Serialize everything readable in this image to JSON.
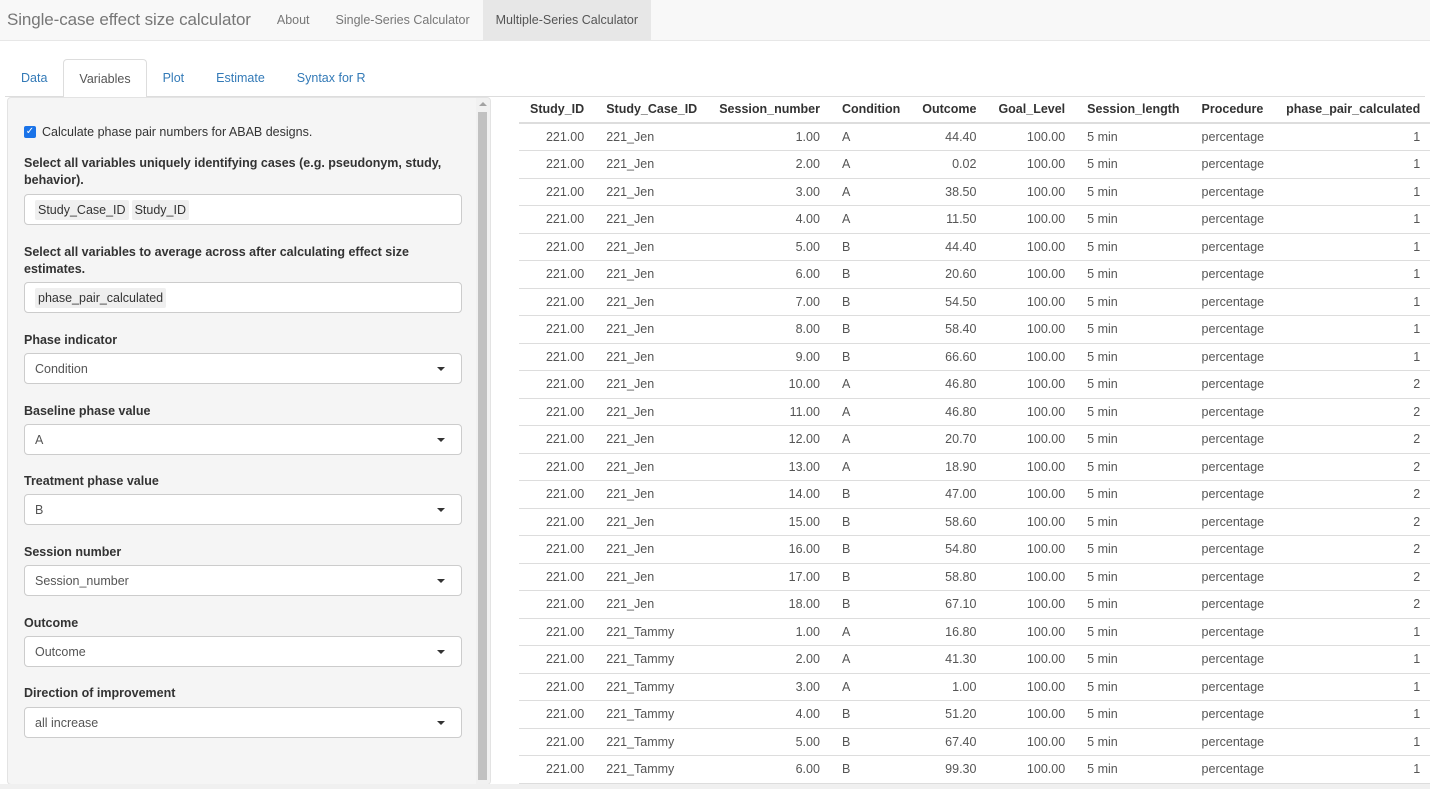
{
  "navbar": {
    "brand": "Single-case effect size calculator",
    "items": [
      {
        "label": "About",
        "active": false
      },
      {
        "label": "Single-Series Calculator",
        "active": false
      },
      {
        "label": "Multiple-Series Calculator",
        "active": true
      }
    ]
  },
  "tabs": [
    {
      "label": "Data",
      "active": false
    },
    {
      "label": "Variables",
      "active": true
    },
    {
      "label": "Plot",
      "active": false
    },
    {
      "label": "Estimate",
      "active": false
    },
    {
      "label": "Syntax for R",
      "active": false
    }
  ],
  "panel": {
    "checkbox": {
      "label": "Calculate phase pair numbers for ABAB designs.",
      "checked": true
    },
    "case_vars": {
      "label": "Select all variables uniquely identifying cases (e.g. pseudonym, study, behavior).",
      "selected": [
        "Study_Case_ID",
        "Study_ID"
      ]
    },
    "avg_vars": {
      "label": "Select all variables to average across after calculating effect size estimates.",
      "selected": [
        "phase_pair_calculated"
      ]
    },
    "phase_indicator": {
      "label": "Phase indicator",
      "value": "Condition"
    },
    "baseline_phase": {
      "label": "Baseline phase value",
      "value": "A"
    },
    "treatment_phase": {
      "label": "Treatment phase value",
      "value": "B"
    },
    "session_number": {
      "label": "Session number",
      "value": "Session_number"
    },
    "outcome": {
      "label": "Outcome",
      "value": "Outcome"
    },
    "direction": {
      "label": "Direction of improvement",
      "value": "all increase"
    }
  },
  "table": {
    "columns": [
      "Study_ID",
      "Study_Case_ID",
      "Session_number",
      "Condition",
      "Outcome",
      "Goal_Level",
      "Session_length",
      "Procedure",
      "phase_pair_calculated"
    ],
    "rows": [
      [
        "221.00",
        "221_Jen",
        "1.00",
        "A",
        "44.40",
        "100.00",
        "5 min",
        "percentage",
        "1"
      ],
      [
        "221.00",
        "221_Jen",
        "2.00",
        "A",
        "0.02",
        "100.00",
        "5 min",
        "percentage",
        "1"
      ],
      [
        "221.00",
        "221_Jen",
        "3.00",
        "A",
        "38.50",
        "100.00",
        "5 min",
        "percentage",
        "1"
      ],
      [
        "221.00",
        "221_Jen",
        "4.00",
        "A",
        "11.50",
        "100.00",
        "5 min",
        "percentage",
        "1"
      ],
      [
        "221.00",
        "221_Jen",
        "5.00",
        "B",
        "44.40",
        "100.00",
        "5 min",
        "percentage",
        "1"
      ],
      [
        "221.00",
        "221_Jen",
        "6.00",
        "B",
        "20.60",
        "100.00",
        "5 min",
        "percentage",
        "1"
      ],
      [
        "221.00",
        "221_Jen",
        "7.00",
        "B",
        "54.50",
        "100.00",
        "5 min",
        "percentage",
        "1"
      ],
      [
        "221.00",
        "221_Jen",
        "8.00",
        "B",
        "58.40",
        "100.00",
        "5 min",
        "percentage",
        "1"
      ],
      [
        "221.00",
        "221_Jen",
        "9.00",
        "B",
        "66.60",
        "100.00",
        "5 min",
        "percentage",
        "1"
      ],
      [
        "221.00",
        "221_Jen",
        "10.00",
        "A",
        "46.80",
        "100.00",
        "5 min",
        "percentage",
        "2"
      ],
      [
        "221.00",
        "221_Jen",
        "11.00",
        "A",
        "46.80",
        "100.00",
        "5 min",
        "percentage",
        "2"
      ],
      [
        "221.00",
        "221_Jen",
        "12.00",
        "A",
        "20.70",
        "100.00",
        "5 min",
        "percentage",
        "2"
      ],
      [
        "221.00",
        "221_Jen",
        "13.00",
        "A",
        "18.90",
        "100.00",
        "5 min",
        "percentage",
        "2"
      ],
      [
        "221.00",
        "221_Jen",
        "14.00",
        "B",
        "47.00",
        "100.00",
        "5 min",
        "percentage",
        "2"
      ],
      [
        "221.00",
        "221_Jen",
        "15.00",
        "B",
        "58.60",
        "100.00",
        "5 min",
        "percentage",
        "2"
      ],
      [
        "221.00",
        "221_Jen",
        "16.00",
        "B",
        "54.80",
        "100.00",
        "5 min",
        "percentage",
        "2"
      ],
      [
        "221.00",
        "221_Jen",
        "17.00",
        "B",
        "58.80",
        "100.00",
        "5 min",
        "percentage",
        "2"
      ],
      [
        "221.00",
        "221_Jen",
        "18.00",
        "B",
        "67.10",
        "100.00",
        "5 min",
        "percentage",
        "2"
      ],
      [
        "221.00",
        "221_Tammy",
        "1.00",
        "A",
        "16.80",
        "100.00",
        "5 min",
        "percentage",
        "1"
      ],
      [
        "221.00",
        "221_Tammy",
        "2.00",
        "A",
        "41.30",
        "100.00",
        "5 min",
        "percentage",
        "1"
      ],
      [
        "221.00",
        "221_Tammy",
        "3.00",
        "A",
        "1.00",
        "100.00",
        "5 min",
        "percentage",
        "1"
      ],
      [
        "221.00",
        "221_Tammy",
        "4.00",
        "B",
        "51.20",
        "100.00",
        "5 min",
        "percentage",
        "1"
      ],
      [
        "221.00",
        "221_Tammy",
        "5.00",
        "B",
        "67.40",
        "100.00",
        "5 min",
        "percentage",
        "1"
      ],
      [
        "221.00",
        "221_Tammy",
        "6.00",
        "B",
        "99.30",
        "100.00",
        "5 min",
        "percentage",
        "1"
      ]
    ]
  },
  "colors": {
    "accent": "#337ab7",
    "checkbox": "#1a73e8",
    "navbar_bg": "#f8f8f8",
    "panel_bg": "#f5f5f5"
  }
}
